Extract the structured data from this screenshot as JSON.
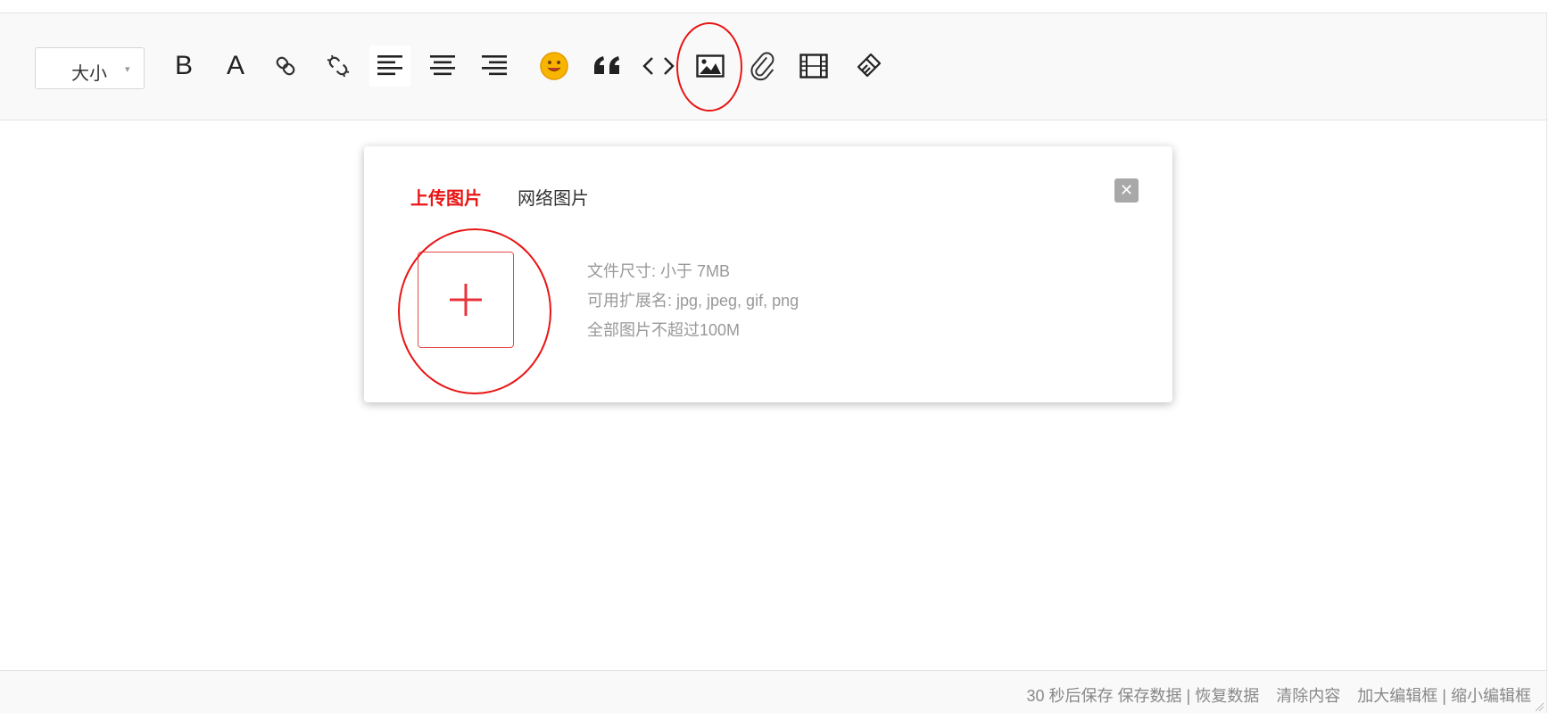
{
  "toolbar": {
    "size_select": {
      "label": "大小",
      "caret": "▾"
    },
    "buttons": [
      {
        "name": "bold",
        "text": "B"
      },
      {
        "name": "font-color",
        "text": "A"
      },
      {
        "name": "link",
        "icon": "link-icon"
      },
      {
        "name": "unlink",
        "icon": "unlink-icon"
      },
      {
        "name": "align-left",
        "icon": "align-left-icon",
        "active": true
      },
      {
        "name": "align-center",
        "icon": "align-center-icon"
      },
      {
        "name": "align-right",
        "icon": "align-right-icon"
      },
      {
        "name": "emoji",
        "icon": "smiley-icon"
      },
      {
        "name": "quote",
        "icon": "quote-icon"
      },
      {
        "name": "code",
        "icon": "code-icon"
      },
      {
        "name": "image",
        "icon": "image-icon"
      },
      {
        "name": "attachment",
        "icon": "paperclip-icon"
      },
      {
        "name": "video",
        "icon": "film-icon"
      },
      {
        "name": "clear-format",
        "icon": "brush-icon"
      }
    ]
  },
  "image_dialog": {
    "tabs": [
      {
        "label": "上传图片",
        "active": true
      },
      {
        "label": "网络图片",
        "active": false
      }
    ],
    "close_symbol": "✕",
    "info_lines": [
      "文件尺寸: 小于 7MB",
      "可用扩展名: jpg, jpeg, gif, png",
      "全部图片不超过100M"
    ]
  },
  "statusbar": {
    "autosave": "30 秒后保存",
    "save_data": "保存数据",
    "separator1": "|",
    "restore_data": "恢复数据",
    "clear_content": "清除内容",
    "enlarge_editor": "加大编辑框",
    "separator2": "|",
    "shrink_editor": "缩小编辑框"
  },
  "colors": {
    "accent_red": "#e81515",
    "toolbar_bg": "#f9f9f9",
    "muted_text": "#999999",
    "emoji_yellow": "#f7b500"
  }
}
